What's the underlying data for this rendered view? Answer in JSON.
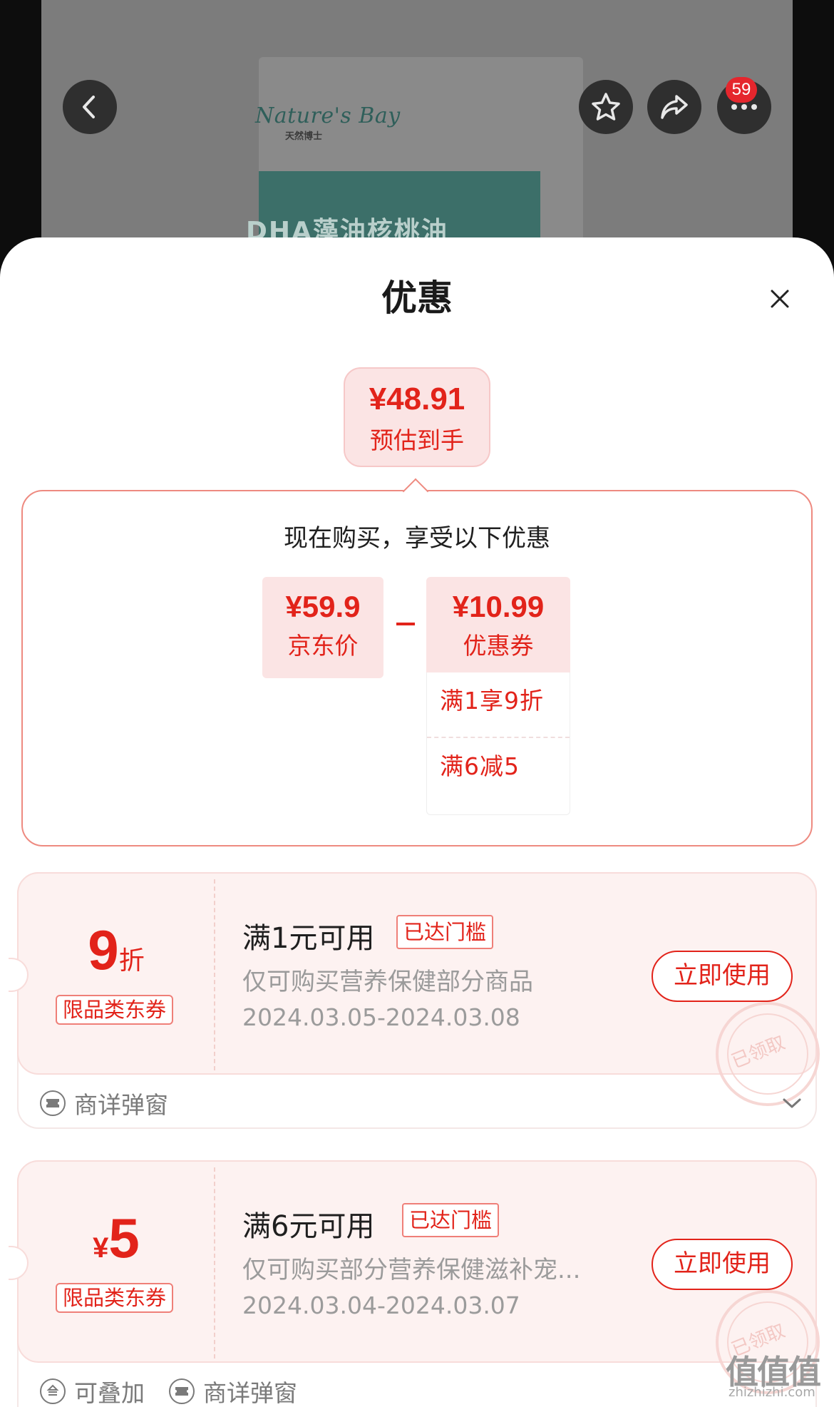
{
  "background": {
    "product_brand": "Nature's Bay",
    "product_brand_cn": "天然博士",
    "product_name": "DHA藻油核桃油",
    "icons": [
      "back-icon",
      "star-icon",
      "share-icon",
      "more-icon"
    ],
    "notification_count": "59"
  },
  "sheet": {
    "title": "优惠",
    "close_icon": "close-icon"
  },
  "estimate": {
    "price": "¥48.91",
    "label": "预估到手"
  },
  "breakdown": {
    "title": "现在购买，享受以下优惠",
    "jd_price": {
      "value": "¥59.9",
      "label": "京东价"
    },
    "coupon": {
      "value": "¥10.99",
      "label": "优惠券"
    },
    "coupon_items": [
      "满1享9折",
      "满6减5"
    ]
  },
  "coupons": [
    {
      "amount": "9",
      "amount_unit": "折",
      "category": "限品类东券",
      "condition": "满1元可用",
      "status": "已达门槛",
      "desc": "仅可购买营养保健部分商品",
      "date": "2024.03.05-2024.03.08",
      "button": "立即使用",
      "stamp": "已领取",
      "footer": [
        {
          "icon": "coupon-source-icon",
          "label": "商详弹窗"
        }
      ]
    },
    {
      "amount": "5",
      "currency": "¥",
      "category": "限品类东券",
      "condition": "满6元可用",
      "status": "已达门槛",
      "desc": "仅可购买部分营养保健滋补宠...",
      "date": "2024.03.04-2024.03.07",
      "button": "立即使用",
      "stamp": "已领取",
      "footer": [
        {
          "icon": "stackable-icon",
          "label": "可叠加"
        },
        {
          "icon": "coupon-source-icon",
          "label": "商详弹窗"
        }
      ]
    }
  ],
  "watermark": {
    "main": "值值值",
    "sub": "zhizhizhi.com"
  },
  "colors": {
    "accent": "#e2231a",
    "chip_bg": "#fbe4e4",
    "card_bg": "#fdf2f1"
  }
}
